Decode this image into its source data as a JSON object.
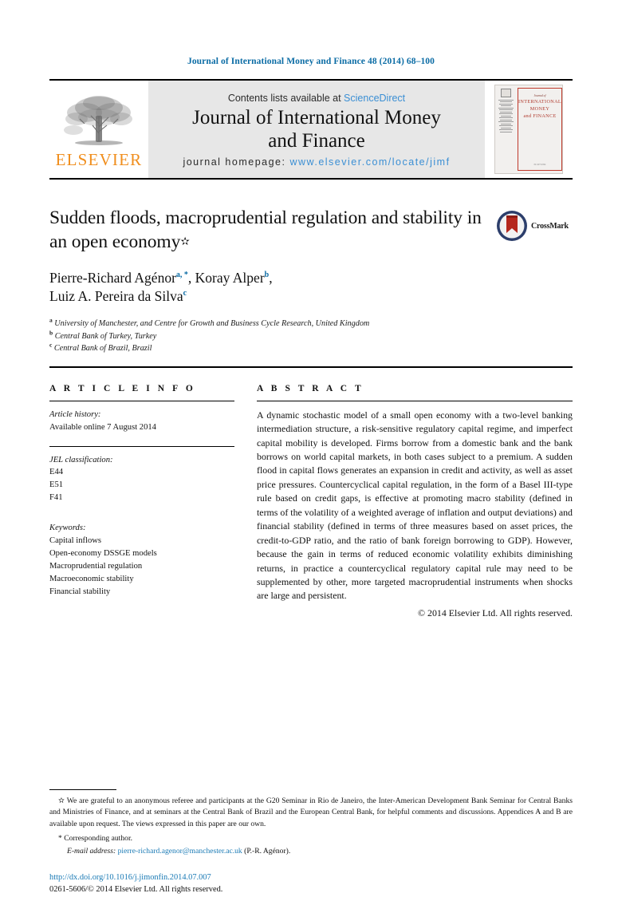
{
  "running_head": "Journal of International Money and Finance 48 (2014) 68–100",
  "masthead": {
    "publisher_name": "ELSEVIER",
    "contents_prefix": "Contents lists available at ",
    "contents_link": "ScienceDirect",
    "journal_title_line1": "Journal of International Money",
    "journal_title_line2": "and Finance",
    "homepage_prefix": "journal homepage: ",
    "homepage_url": "www.elsevier.com/locate/jimf",
    "cover": {
      "pre_title": "Journal of",
      "line1": "INTERNATIONAL",
      "line2": "MONEY",
      "line3": "and FINANCE",
      "footer": "ELSEVIER"
    }
  },
  "article": {
    "title": "Sudden floods, macroprudential regulation and stability in an open economy",
    "title_marker": "✫",
    "authors_line1_name1": "Pierre-Richard Agénor",
    "authors_line1_sup1": "a, *",
    "authors_line1_name2": "Koray Alper",
    "authors_line1_sup2": "b",
    "authors_line2_name": "Luiz A. Pereira da Silva",
    "authors_line2_sup": "c",
    "crossmark_label": "CrossMark",
    "affiliations": [
      {
        "marker": "a",
        "text": "University of Manchester, and Centre for Growth and Business Cycle Research, United Kingdom"
      },
      {
        "marker": "b",
        "text": "Central Bank of Turkey, Turkey"
      },
      {
        "marker": "c",
        "text": "Central Bank of Brazil, Brazil"
      }
    ]
  },
  "article_info": {
    "heading": "A R T I C L E   I N F O",
    "history_label": "Article history:",
    "history_value": "Available online 7 August 2014",
    "jel_label": "JEL classification:",
    "jel_codes": [
      "E44",
      "E51",
      "F41"
    ],
    "keywords_label": "Keywords:",
    "keywords": [
      "Capital inflows",
      "Open-economy DSSGE models",
      "Macroprudential regulation",
      "Macroeconomic stability",
      "Financial stability"
    ]
  },
  "abstract": {
    "heading": "A B S T R A C T",
    "body": "A dynamic stochastic model of a small open economy with a two-level banking intermediation structure, a risk-sensitive regulatory capital regime, and imperfect capital mobility is developed. Firms borrow from a domestic bank and the bank borrows on world capital markets, in both cases subject to a premium. A sudden flood in capital flows generates an expansion in credit and activity, as well as asset price pressures. Countercyclical capital regulation, in the form of a Basel III-type rule based on credit gaps, is effective at promoting macro stability (defined in terms of the volatility of a weighted average of inflation and output deviations) and financial stability (defined in terms of three measures based on asset prices, the credit-to-GDP ratio, and the ratio of bank foreign borrowing to GDP). However, because the gain in terms of reduced economic volatility exhibits diminishing returns, in practice a countercyclical regulatory capital rule may need to be supplemented by other, more targeted macroprudential instruments when shocks are large and persistent.",
    "copyright": "© 2014 Elsevier Ltd. All rights reserved."
  },
  "footnotes": {
    "acknowledgement_marker": "✫",
    "acknowledgement": "We are grateful to an anonymous referee and participants at the G20 Seminar in Rio de Janeiro, the Inter-American Development Bank Seminar for Central Banks and Ministries of Finance, and at seminars at the Central Bank of Brazil and the European Central Bank, for helpful comments and discussions. Appendices A and B are available upon request. The views expressed in this paper are our own.",
    "corresponding_marker": "*",
    "corresponding_text": "Corresponding author.",
    "email_label": "E-mail address:",
    "email_address": "pierre-richard.agenor@manchester.ac.uk",
    "email_owner": "(P.-R. Agénor)."
  },
  "bottom": {
    "doi": "http://dx.doi.org/10.1016/j.jimonfin.2014.07.007",
    "issn_line": "0261-5606/© 2014 Elsevier Ltd. All rights reserved."
  },
  "colors": {
    "journal_blue": "#0b6ca5",
    "link_blue": "#1a7ab5",
    "sciencedirect_blue": "#3b8fd4",
    "elsevier_orange": "#f08e1d",
    "cover_red": "#c0392b",
    "masthead_grey": "#e7e7e7"
  }
}
